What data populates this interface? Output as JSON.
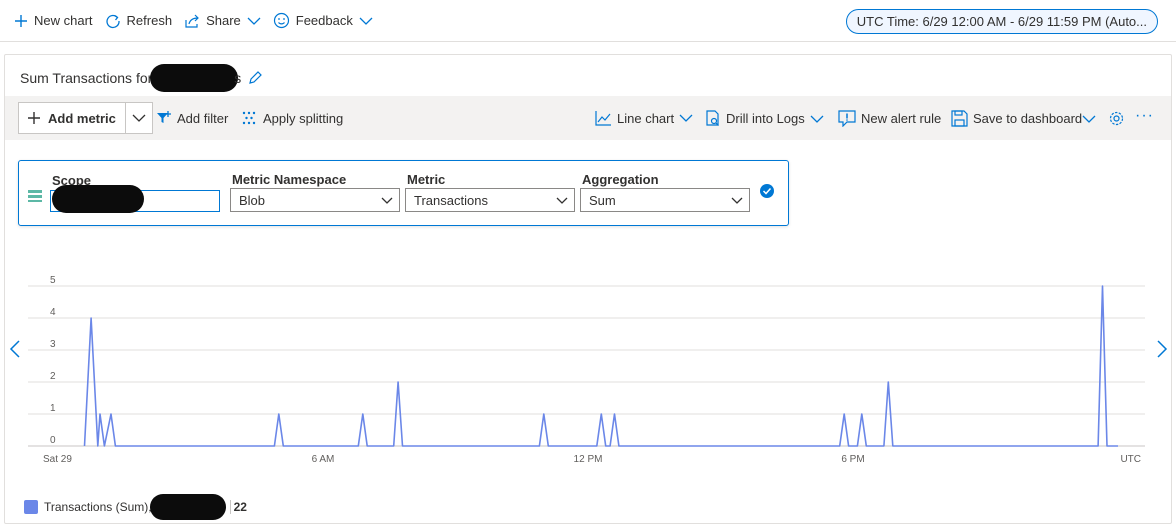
{
  "topbar": {
    "new_chart": "New chart",
    "refresh": "Refresh",
    "share": "Share",
    "feedback": "Feedback",
    "time_range": "UTC Time: 6/29 12:00 AM - 6/29 11:59 PM (Auto..."
  },
  "chart": {
    "title": "Sum Transactions for",
    "title_suffix": "s"
  },
  "toolbar": {
    "add_metric": "Add metric",
    "add_filter": "Add filter",
    "apply_splitting": "Apply splitting",
    "line_chart": "Line chart",
    "drill_logs": "Drill into Logs",
    "new_alert": "New alert rule",
    "save_dashboard": "Save to dashboard",
    "more": "···"
  },
  "metric": {
    "scope_label": "Scope",
    "namespace_label": "Metric Namespace",
    "namespace_value": "Blob",
    "metric_label": "Metric",
    "metric_value": "Transactions",
    "aggregation_label": "Aggregation",
    "aggregation_value": "Sum"
  },
  "legend": {
    "series_label": "Transactions (Sum),",
    "value": "22"
  },
  "colors": {
    "accent": "#0078d4",
    "series": "#6b87e8"
  },
  "chart_data": {
    "type": "line",
    "x_ticks": [
      "Sat 29",
      "6 AM",
      "12 PM",
      "6 PM",
      "UTC"
    ],
    "y_ticks": [
      "0",
      "1",
      "2",
      "3",
      "4",
      "5"
    ],
    "ylim": [
      0,
      5
    ],
    "x_unit": "hours since 12:00 AM",
    "xlim": [
      0,
      24
    ],
    "series": [
      {
        "name": "Transactions (Sum)",
        "points": [
          [
            0.6,
            0
          ],
          [
            0.75,
            4
          ],
          [
            0.9,
            0
          ],
          [
            0.95,
            1
          ],
          [
            1.05,
            0
          ],
          [
            1.2,
            1
          ],
          [
            1.3,
            0
          ],
          [
            4.9,
            0
          ],
          [
            5.0,
            1
          ],
          [
            5.1,
            0
          ],
          [
            6.8,
            0
          ],
          [
            6.9,
            1
          ],
          [
            7.0,
            0
          ],
          [
            7.6,
            0
          ],
          [
            7.7,
            2
          ],
          [
            7.8,
            0
          ],
          [
            10.9,
            0
          ],
          [
            11.0,
            1
          ],
          [
            11.1,
            0
          ],
          [
            12.2,
            0
          ],
          [
            12.3,
            1
          ],
          [
            12.4,
            0
          ],
          [
            12.5,
            0
          ],
          [
            12.6,
            1
          ],
          [
            12.7,
            0
          ],
          [
            17.7,
            0
          ],
          [
            17.8,
            1
          ],
          [
            17.9,
            0
          ],
          [
            18.1,
            0
          ],
          [
            18.2,
            1
          ],
          [
            18.3,
            0
          ],
          [
            18.7,
            0
          ],
          [
            18.8,
            2
          ],
          [
            18.9,
            0
          ],
          [
            23.55,
            0
          ],
          [
            23.65,
            5
          ],
          [
            23.75,
            0
          ],
          [
            24.0,
            0
          ]
        ]
      }
    ]
  }
}
